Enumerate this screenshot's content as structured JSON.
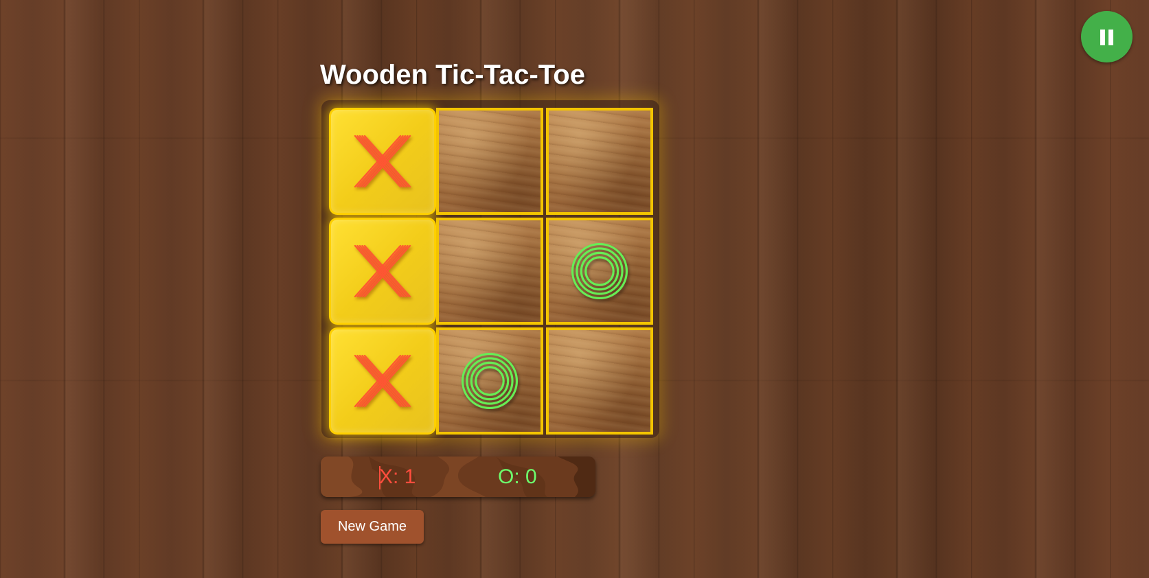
{
  "game": {
    "title": "Wooden Tic-Tac-Toe"
  },
  "board": {
    "cells": [
      {
        "row": 0,
        "col": 0,
        "mark": "X",
        "winning": true
      },
      {
        "row": 0,
        "col": 1,
        "mark": "",
        "winning": false
      },
      {
        "row": 0,
        "col": 2,
        "mark": "",
        "winning": false
      },
      {
        "row": 1,
        "col": 0,
        "mark": "X",
        "winning": true
      },
      {
        "row": 1,
        "col": 1,
        "mark": "",
        "winning": false
      },
      {
        "row": 1,
        "col": 2,
        "mark": "O",
        "winning": false
      },
      {
        "row": 2,
        "col": 0,
        "mark": "X",
        "winning": true
      },
      {
        "row": 2,
        "col": 1,
        "mark": "O",
        "winning": false
      },
      {
        "row": 2,
        "col": 2,
        "mark": "",
        "winning": false
      }
    ]
  },
  "scoreboard": {
    "x_score": "X: 1",
    "o_score": "O: 0"
  },
  "controls": {
    "new_game_label": "New Game",
    "pause_icon": "pause-icon"
  },
  "colors": {
    "x_mark": "#ff5533",
    "o_mark": "#66ee55",
    "win_cell": "#f5d010",
    "cell_border": "#f3c400",
    "pause_button": "#43b049",
    "new_game_button": "#a0522d"
  }
}
